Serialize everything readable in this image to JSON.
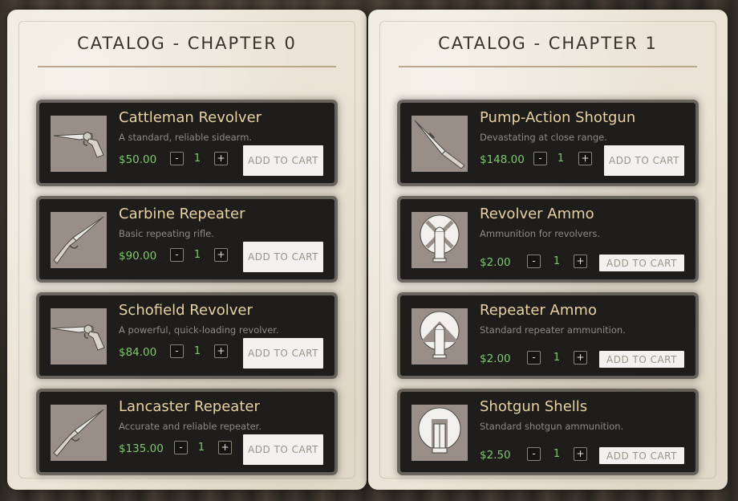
{
  "colors": {
    "panel": "#ebe4d6",
    "card": "#1f1d1b",
    "name": "#e6d2a2",
    "price": "#7fc76e",
    "desc": "#8f8b86",
    "thumb_bg": "#9a8f88"
  },
  "chapters": [
    {
      "title": "CATALOG - CHAPTER 0",
      "items": [
        {
          "name": "Cattleman Revolver",
          "desc": "A standard, reliable sidearm.",
          "price": "$50.00",
          "qty": "1",
          "minus": "-",
          "plus": "+",
          "cart": "ADD TO CART",
          "icon": "revolver-icon"
        },
        {
          "name": "Carbine Repeater",
          "desc": "Basic repeating rifle.",
          "price": "$90.00",
          "qty": "1",
          "minus": "-",
          "plus": "+",
          "cart": "ADD TO CART",
          "icon": "rifle-icon"
        },
        {
          "name": "Schofield Revolver",
          "desc": "A powerful, quick-loading revolver.",
          "price": "$84.00",
          "qty": "1",
          "minus": "-",
          "plus": "+",
          "cart": "ADD TO CART",
          "icon": "revolver-icon"
        },
        {
          "name": "Lancaster Repeater",
          "desc": "Accurate and reliable repeater.",
          "price": "$135.00",
          "qty": "1",
          "minus": "-",
          "plus": "+",
          "cart": "ADD TO CART",
          "icon": "rifle-icon"
        }
      ]
    },
    {
      "title": "CATALOG - CHAPTER 1",
      "items": [
        {
          "name": "Pump-Action Shotgun",
          "desc": "Devastating at close range.",
          "price": "$148.00",
          "qty": "1",
          "minus": "-",
          "plus": "+",
          "cart": "ADD TO CART",
          "icon": "shotgun-icon"
        },
        {
          "name": "Revolver Ammo",
          "desc": "Ammunition for revolvers.",
          "price": "$2.00",
          "qty": "1",
          "minus": "-",
          "plus": "+",
          "cart": "ADD TO CART",
          "icon": "revolver-ammo-icon"
        },
        {
          "name": "Repeater Ammo",
          "desc": "Standard repeater ammunition.",
          "price": "$2.00",
          "qty": "1",
          "minus": "-",
          "plus": "+",
          "cart": "ADD TO CART",
          "icon": "repeater-ammo-icon"
        },
        {
          "name": "Shotgun Shells",
          "desc": "Standard shotgun ammunition.",
          "price": "$2.50",
          "qty": "1",
          "minus": "-",
          "plus": "+",
          "cart": "ADD TO CART",
          "icon": "shotgun-shells-icon"
        }
      ]
    }
  ]
}
